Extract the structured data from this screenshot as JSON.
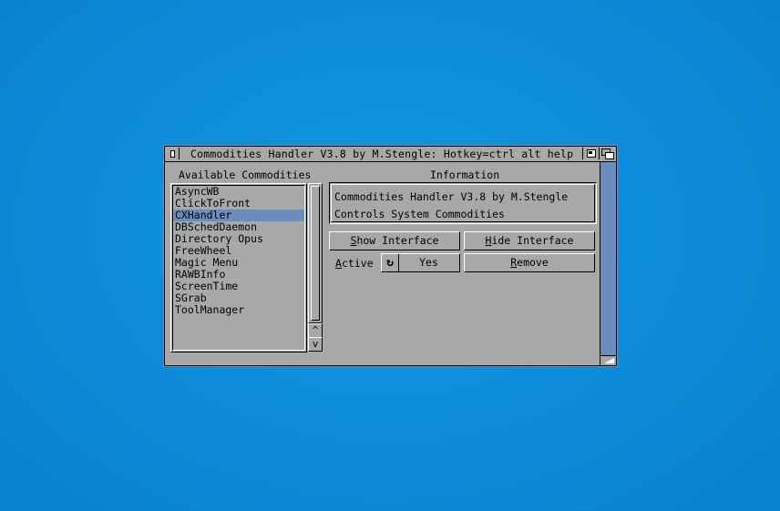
{
  "window": {
    "title": "Commodities Handler V3.8 by M.Stengle: Hotkey=ctrl alt help"
  },
  "available": {
    "heading": "Available Commodities",
    "items": [
      "AsyncWB",
      "ClickToFront",
      "CXHandler",
      "DBSchedDaemon",
      "Directory Opus",
      "FreeWheel",
      "Magic Menu",
      "RAWBInfo",
      "ScreenTime",
      "SGrab",
      "ToolManager"
    ],
    "selected": "CXHandler"
  },
  "info": {
    "heading": "Information",
    "line1": "Commodities Handler V3.8 by M.Stengle",
    "line2": "Controls System Commodities"
  },
  "buttons": {
    "show_interface_u": "S",
    "show_interface_rest": "how Interface",
    "hide_interface_u": "H",
    "hide_interface_rest": "ide Interface",
    "remove_u": "R",
    "remove_rest": "emove"
  },
  "active": {
    "label_u": "A",
    "label_rest": "ctive",
    "value": "Yes"
  },
  "colors": {
    "desktop": "#0d8bd8",
    "window": "#a8a8a8",
    "selection": "#6a8dbd"
  },
  "icons": {
    "scroll_up": "^",
    "scroll_down": "v"
  }
}
